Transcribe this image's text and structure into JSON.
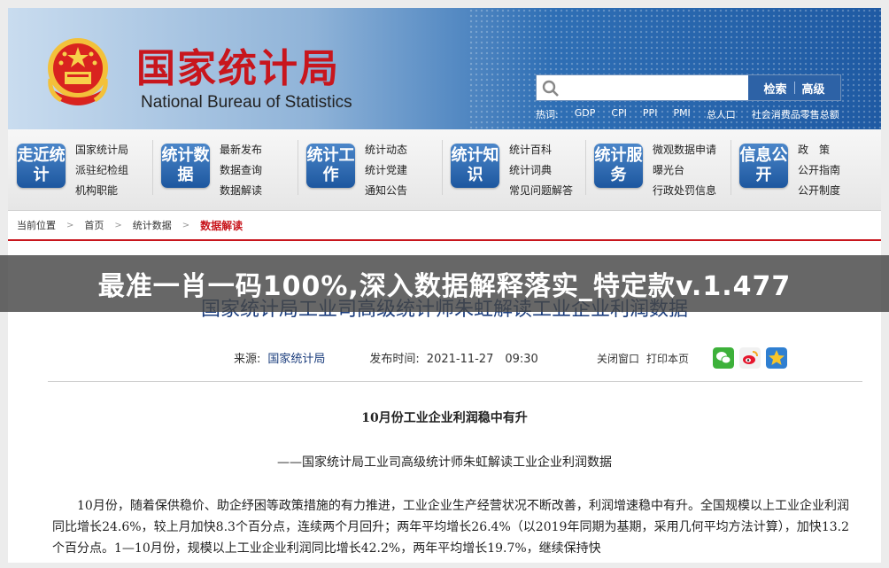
{
  "header": {
    "title": "国家统计局",
    "subtitle": "National Bureau of Statistics",
    "search": {
      "placeholder": "",
      "button_label": "检索",
      "advanced_label": "高级"
    },
    "hot_words_label": "热词:",
    "hot_words": [
      "GDP",
      "CPI",
      "PPI",
      "PMI",
      "总人口",
      "社会消费品零售总额"
    ]
  },
  "nav": [
    {
      "badge": "走近统计",
      "links": [
        "国家统计局",
        "派驻纪检组",
        "机构职能"
      ]
    },
    {
      "badge": "统计数据",
      "links": [
        "最新发布",
        "数据查询",
        "数据解读"
      ]
    },
    {
      "badge": "统计工作",
      "links": [
        "统计动态",
        "统计党建",
        "通知公告"
      ]
    },
    {
      "badge": "统计知识",
      "links": [
        "统计百科",
        "统计词典",
        "常见问题解答"
      ]
    },
    {
      "badge": "统计服务",
      "links": [
        "微观数据申请",
        "曝光台",
        "行政处罚信息"
      ]
    },
    {
      "badge": "信息公开",
      "links": [
        "政　策",
        "公开指南",
        "公开制度"
      ]
    }
  ],
  "breadcrumb": {
    "items": [
      "当前位置",
      "首页",
      "统计数据"
    ],
    "current": "数据解读"
  },
  "article": {
    "title": "国家统计局工业司高级统计师朱虹解读工业企业利润数据",
    "source_label": "来源:",
    "source_value": "国家统计局",
    "time_label": "发布时间:",
    "time_value": "2021-11-27　09:30",
    "close_label": "关闭窗口",
    "print_label": "打印本页",
    "heading": "10月份工业企业利润稳中有升",
    "subheading": "——国家统计局工业司高级统计师朱虹解读工业企业利润数据",
    "body": "10月份，随着保供稳价、助企纾困等政策措施的有力推进，工业企业生产经营状况不断改善，利润增速稳中有升。全国规模以上工业企业利润同比增长24.6%，较上月加快8.3个百分点，连续两个月回升；两年平均增长26.4%（以2019年同期为基期，采用几何平均方法计算），加快13.2个百分点。1—10月份，规模以上工业企业利润同比增长42.2%，两年平均增长19.7%，继续保持快"
  },
  "banner": {
    "text": "最准一肖一码100%,深入数据解释落实_特定款v.1.477"
  },
  "colors": {
    "brand_red": "#c8161d",
    "brand_blue": "#1d579f"
  }
}
